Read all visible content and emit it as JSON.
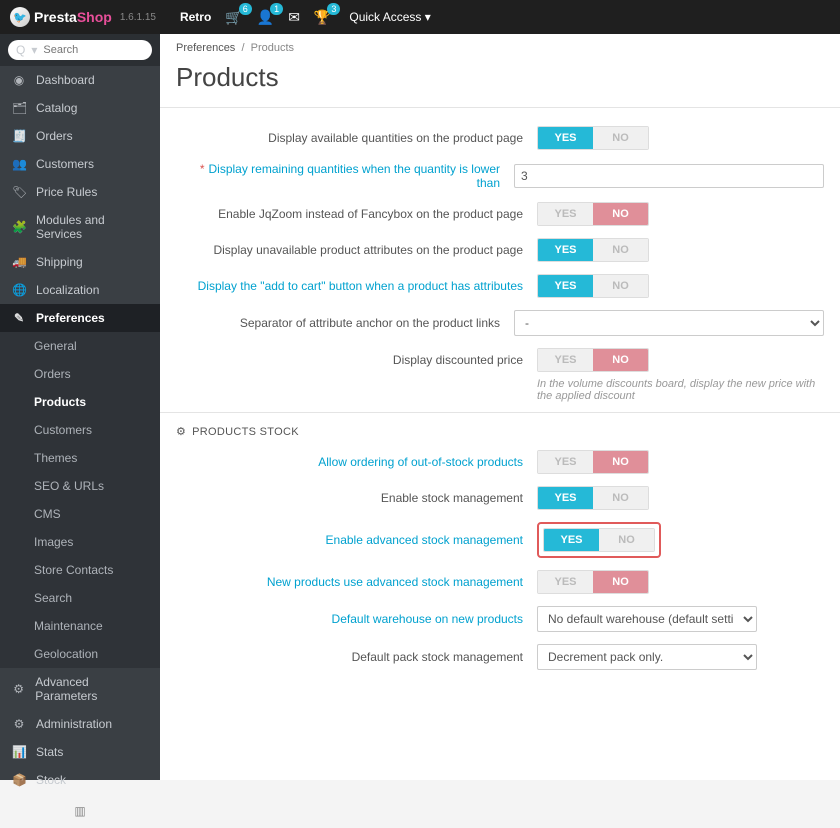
{
  "topbar": {
    "brand_pre": "Presta",
    "brand_accent": "Shop",
    "version": "1.6.1.15",
    "shop_name": "Retro",
    "badges": {
      "cart": "6",
      "user": "1",
      "trophy": "3"
    },
    "quick_access": "Quick Access"
  },
  "search": {
    "placeholder": "Search",
    "dropdown_glyph": "▾",
    "icon_glyph": "Q"
  },
  "sidebar": {
    "items": [
      {
        "label": "Dashboard",
        "icon": "◉"
      },
      {
        "label": "Catalog",
        "icon": "🗂"
      },
      {
        "label": "Orders",
        "icon": "🧾"
      },
      {
        "label": "Customers",
        "icon": "👥"
      },
      {
        "label": "Price Rules",
        "icon": "🏷"
      },
      {
        "label": "Modules and Services",
        "icon": "🧩"
      },
      {
        "label": "Shipping",
        "icon": "🚚"
      },
      {
        "label": "Localization",
        "icon": "🌐"
      },
      {
        "label": "Preferences",
        "icon": "✎"
      },
      {
        "label": "Advanced Parameters",
        "icon": "⚙"
      },
      {
        "label": "Administration",
        "icon": "⚙"
      },
      {
        "label": "Stats",
        "icon": "📊"
      },
      {
        "label": "Stock",
        "icon": "📦"
      }
    ],
    "sub_preferences": [
      "General",
      "Orders",
      "Products",
      "Customers",
      "Themes",
      "SEO & URLs",
      "CMS",
      "Images",
      "Store Contacts",
      "Search",
      "Maintenance",
      "Geolocation"
    ]
  },
  "breadcrumb": {
    "parent": "Preferences",
    "sep": "/",
    "current": "Products"
  },
  "page": {
    "title": "Products"
  },
  "panels": {
    "products": {
      "rows": {
        "display_qty": {
          "label": "Display available quantities on the product page",
          "value": "YES"
        },
        "remaining_low": {
          "label": "Display remaining quantities when the quantity is lower than",
          "value": "3",
          "required": true
        },
        "jqzoom": {
          "label": "Enable JqZoom instead of Fancybox on the product page",
          "value": "NO"
        },
        "unavailable_attr": {
          "label": "Display unavailable product attributes on the product page",
          "value": "YES"
        },
        "add_to_cart_attr": {
          "label": "Display the \"add to cart\" button when a product has attributes",
          "value": "YES"
        },
        "separator": {
          "label": "Separator of attribute anchor on the product links",
          "value": "-"
        },
        "discounted_price": {
          "label": "Display discounted price",
          "value": "NO",
          "hint": "In the volume discounts board, display the new price with the applied discount"
        }
      }
    },
    "stock": {
      "title": "PRODUCTS STOCK",
      "icon": "⚙",
      "rows": {
        "oos_order": {
          "label": "Allow ordering of out-of-stock products",
          "value": "NO"
        },
        "stock_mgmt": {
          "label": "Enable stock management",
          "value": "YES"
        },
        "adv_stock": {
          "label": "Enable advanced stock management",
          "value": "YES"
        },
        "new_prod_adv": {
          "label": "New products use advanced stock management",
          "value": "NO"
        },
        "default_wh": {
          "label": "Default warehouse on new products",
          "value": "No default warehouse (default setting)"
        },
        "pack_mgmt": {
          "label": "Default pack stock management",
          "value": "Decrement pack only."
        }
      }
    }
  },
  "toggle_labels": {
    "on": "YES",
    "off": "NO"
  }
}
